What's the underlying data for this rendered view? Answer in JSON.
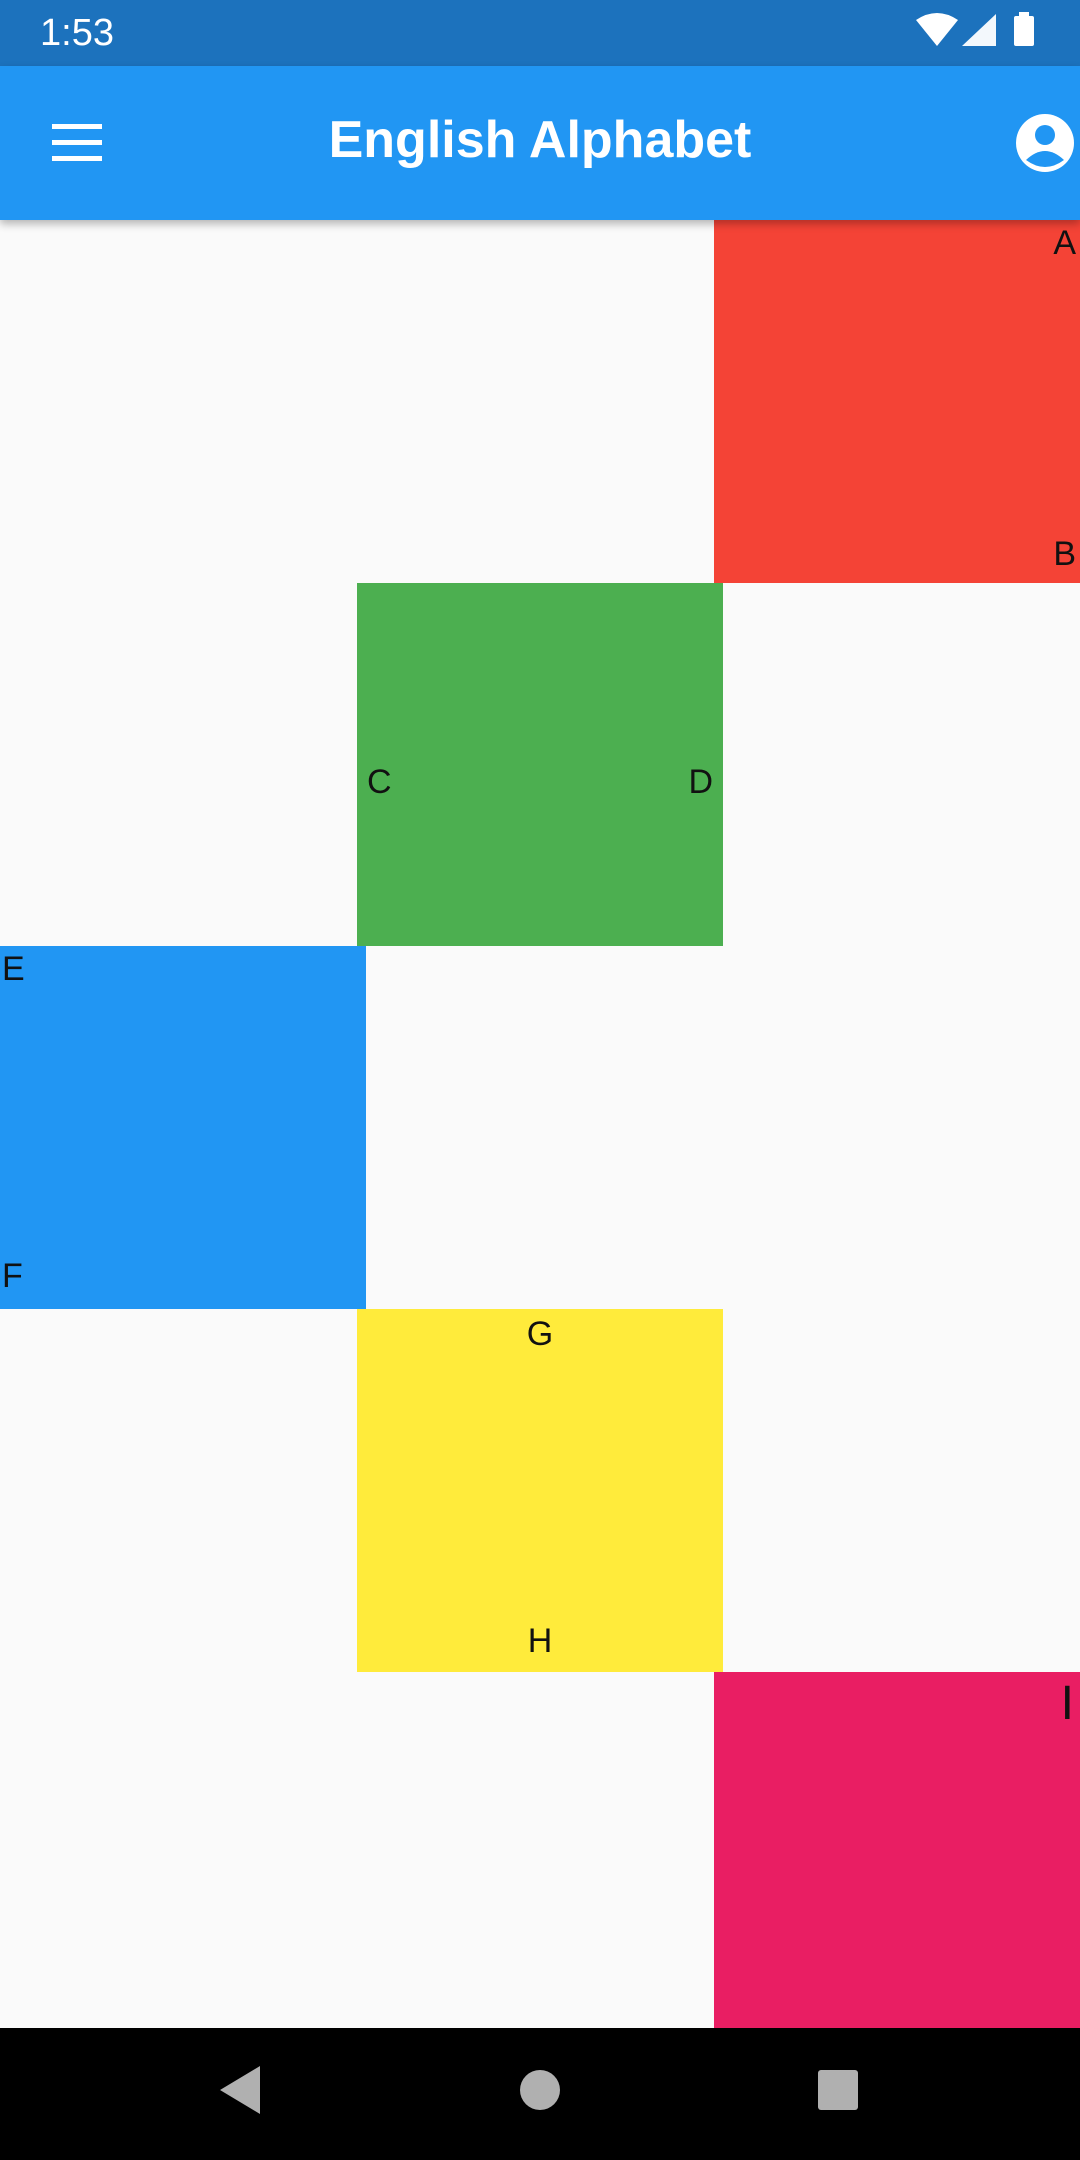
{
  "status_bar": {
    "time": "1:53",
    "icons": [
      "wifi-icon",
      "cell-signal-icon",
      "battery-icon"
    ]
  },
  "app_bar": {
    "title": "English Alphabet",
    "leading_icon": "menu-icon",
    "trailing_icon": "account-circle-icon"
  },
  "tiles": [
    {
      "color": "#f44336",
      "labels": [
        "A",
        "B"
      ]
    },
    {
      "color": "#4caf50",
      "labels": [
        "C",
        "D"
      ]
    },
    {
      "color": "#2196f3",
      "labels": [
        "E",
        "F"
      ]
    },
    {
      "color": "#ffeb3b",
      "labels": [
        "G",
        "H"
      ]
    },
    {
      "color": "#e91e63",
      "labels": [
        "I"
      ]
    }
  ],
  "nav_bar": {
    "icons": [
      "back-icon",
      "home-icon",
      "recents-icon"
    ]
  },
  "colors": {
    "status_bar": "#1c72bd",
    "app_bar": "#2196f3",
    "background": "#fafafa",
    "nav_bar": "#000000"
  }
}
